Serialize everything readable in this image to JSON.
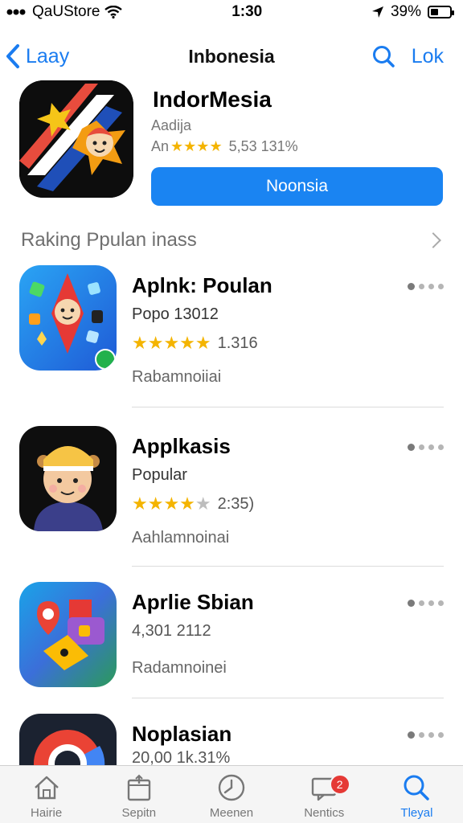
{
  "status_bar": {
    "carrier": "QaUStore",
    "time": "1:30",
    "battery_percent": "39%",
    "battery_level": 0.39
  },
  "nav": {
    "back_label": "Laay",
    "title": "Inbonesia",
    "right_label": "Lok"
  },
  "hero": {
    "title": "IndorMesia",
    "subtitle": "Aadija",
    "rating_prefix": "An",
    "stars": 4,
    "rating_text": "5,53 131%",
    "button_label": "Noonsia"
  },
  "section": {
    "title": "Raking Ppulan inass"
  },
  "apps": [
    {
      "name": "Aplnk: Poulan",
      "subtitle": "Popo 13012",
      "stars": 5,
      "rating_text": "1.316",
      "desc": "Rabamnoiiai"
    },
    {
      "name": "Applkasis",
      "subtitle": "Popular",
      "stars": 4,
      "rating_text": "2:35)",
      "desc": "Aahlamnoinai"
    },
    {
      "name": "Aprlie Sbian",
      "subtitle": "4,301 2112",
      "stars": 0,
      "rating_text": "",
      "desc": "Radamnoinei"
    },
    {
      "name": "Noplasian",
      "subtitle": "20,00 1k.31%",
      "stars": 0,
      "rating_text": "",
      "desc": ""
    }
  ],
  "tabs": [
    {
      "label": "Hairie",
      "icon": "home-icon"
    },
    {
      "label": "Sepitn",
      "icon": "box-icon"
    },
    {
      "label": "Meenen",
      "icon": "clock-icon"
    },
    {
      "label": "Nentics",
      "icon": "message-icon",
      "badge": "2"
    },
    {
      "label": "Tleyal",
      "icon": "search-icon"
    }
  ],
  "colors": {
    "accent": "#1a84f2",
    "star": "#f4b400",
    "badge": "#e53935"
  }
}
